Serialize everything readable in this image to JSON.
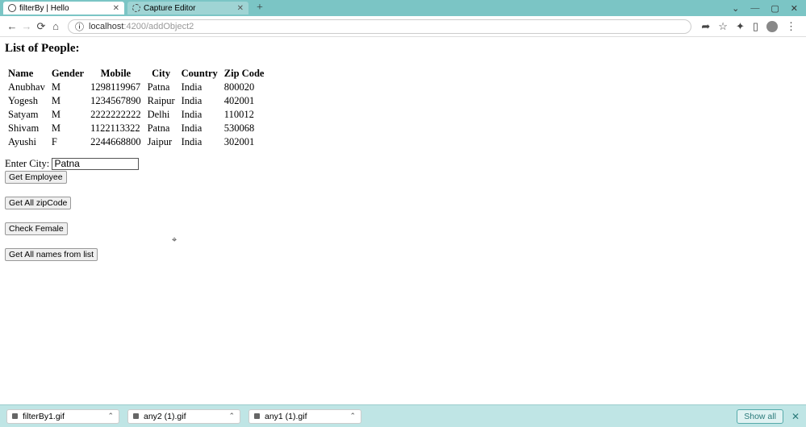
{
  "browser": {
    "tabs": [
      {
        "title": "filterBy | Hello",
        "active": true
      },
      {
        "title": "Capture Editor",
        "active": false
      }
    ],
    "url_host": "localhost",
    "url_port": ":4200",
    "url_path": "/addObject2"
  },
  "page": {
    "heading": "List of People:",
    "columns": [
      "Name",
      "Gender",
      "Mobile",
      "City",
      "Country",
      "Zip Code"
    ],
    "rows": [
      {
        "name": "Anubhav",
        "gender": "M",
        "mobile": "1298119967",
        "city": "Patna",
        "country": "India",
        "zip": "800020"
      },
      {
        "name": "Yogesh",
        "gender": "M",
        "mobile": "1234567890",
        "city": "Raipur",
        "country": "India",
        "zip": "402001"
      },
      {
        "name": "Satyam",
        "gender": "M",
        "mobile": "2222222222",
        "city": "Delhi",
        "country": "India",
        "zip": "110012"
      },
      {
        "name": "Shivam",
        "gender": "M",
        "mobile": "1122113322",
        "city": "Patna",
        "country": "India",
        "zip": "530068"
      },
      {
        "name": "Ayushi",
        "gender": "F",
        "mobile": "2244668800",
        "city": "Jaipur",
        "country": "India",
        "zip": "302001"
      }
    ],
    "city_label": "Enter City:",
    "city_value": "Patna",
    "buttons": {
      "get_employee": "Get Employee",
      "get_all_zip": "Get All zipCode",
      "check_female": "Check Female",
      "get_all_names": "Get All names from list"
    }
  },
  "downloads": {
    "items": [
      {
        "name": "filterBy1.gif"
      },
      {
        "name": "any2 (1).gif"
      },
      {
        "name": "any1 (1).gif"
      }
    ],
    "show_all": "Show all"
  }
}
